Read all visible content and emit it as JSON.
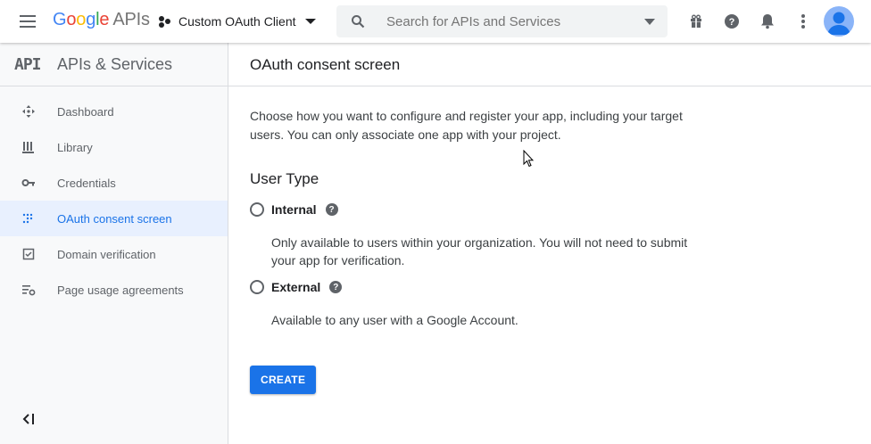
{
  "topbar": {
    "logo": {
      "g1": "G",
      "g2": "o",
      "g3": "o",
      "g4": "g",
      "g5": "l",
      "g6": "e",
      "product": "APIs"
    },
    "project_name": "Custom OAuth Client",
    "search_placeholder": "Search for APIs and Services",
    "icons": [
      "menu-icon",
      "project-icon",
      "search-icon",
      "gift-icon",
      "help-icon",
      "notifications-icon",
      "more-vert-icon",
      "account-icon"
    ]
  },
  "sidebar": {
    "badge": "API",
    "title": "APIs & Services",
    "items": [
      {
        "label": "Dashboard",
        "icon": "dashboard-icon",
        "active": false
      },
      {
        "label": "Library",
        "icon": "library-icon",
        "active": false
      },
      {
        "label": "Credentials",
        "icon": "key-icon",
        "active": false
      },
      {
        "label": "OAuth consent screen",
        "icon": "consent-icon",
        "active": true
      },
      {
        "label": "Domain verification",
        "icon": "checkbox-icon",
        "active": false
      },
      {
        "label": "Page usage agreements",
        "icon": "settings-list-icon",
        "active": false
      }
    ]
  },
  "main": {
    "title": "OAuth consent screen",
    "intro": "Choose how you want to configure and register your app, including your target users. You can only associate one app with your project.",
    "user_type_heading": "User Type",
    "options": [
      {
        "label": "Internal",
        "description": "Only available to users within your organization. You will not need to submit your app for verification."
      },
      {
        "label": "External",
        "description": "Available to any user with a Google Account."
      }
    ],
    "help_glyph": "?",
    "create_label": "CREATE"
  },
  "colors": {
    "accent": "#1a73e8",
    "active_bg": "#e8f0fe",
    "icon_gray": "#5f6368"
  }
}
